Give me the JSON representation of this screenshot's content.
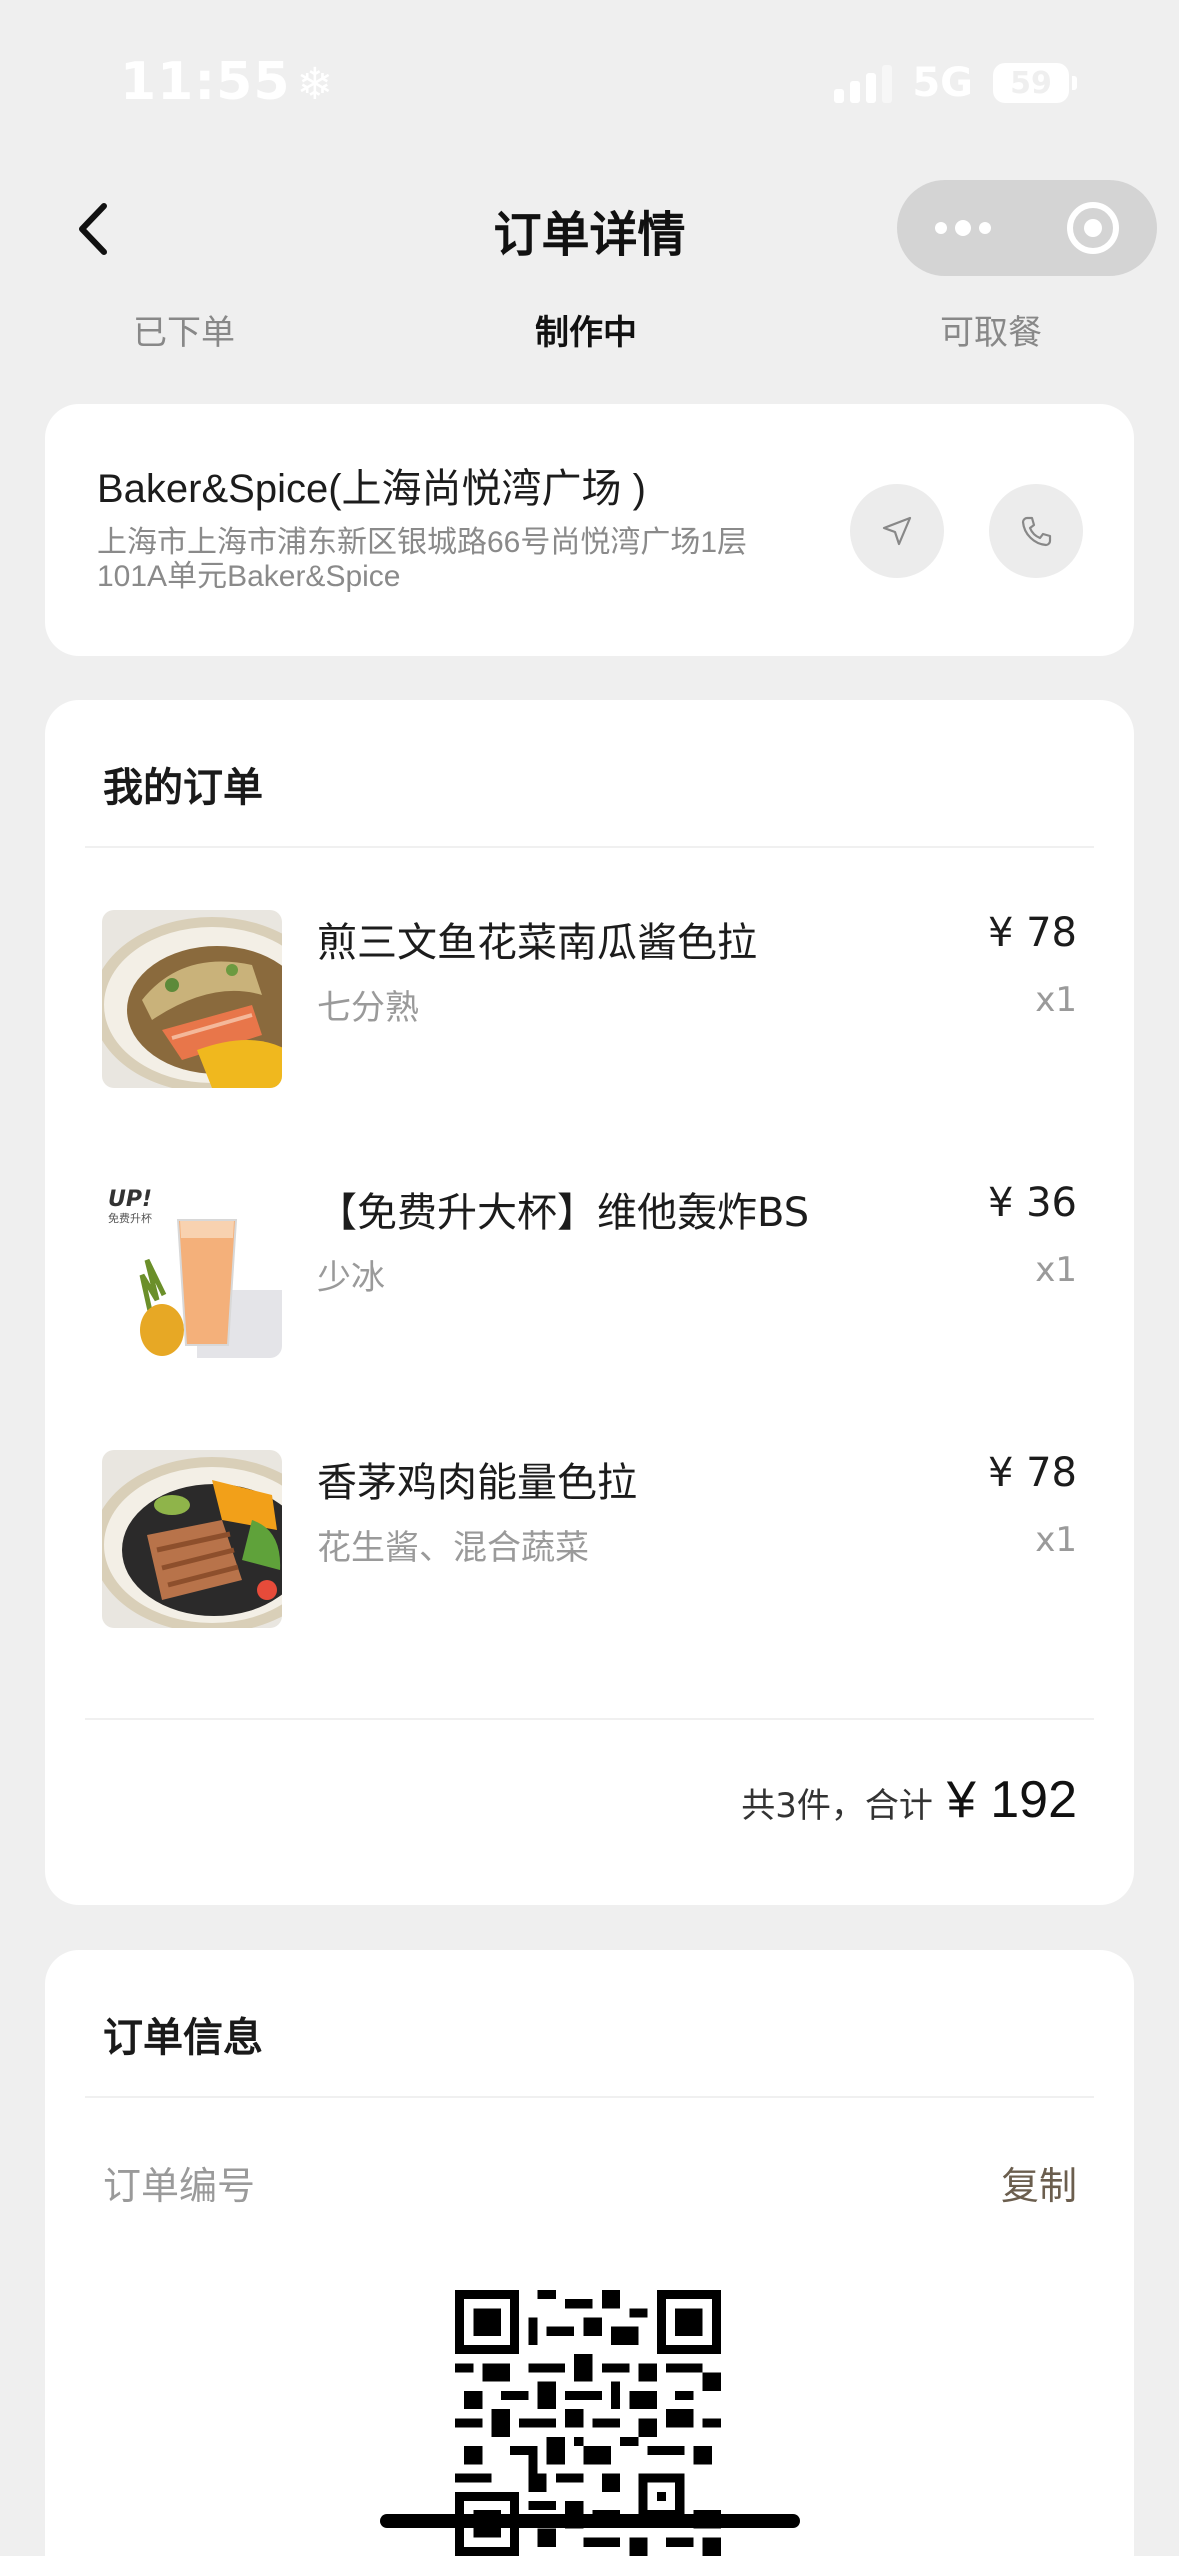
{
  "status_bar": {
    "time": "11:55",
    "snow_glyph": "❄",
    "network": "5G",
    "battery": "59"
  },
  "nav": {
    "title": "订单详情",
    "back_icon": "chevron-left-icon",
    "more_icon": "more-dots-icon",
    "close_icon": "target-icon"
  },
  "steps": [
    "已下单",
    "制作中",
    "可取餐"
  ],
  "store": {
    "name": "Baker&Spice(上海尚悦湾广场 )",
    "address": "上海市上海市浦东新区银城路66号尚悦湾广场1层101A单元Baker&Spice"
  },
  "order": {
    "title": "我的订单",
    "items": [
      {
        "name": "煎三文鱼花菜南瓜酱色拉",
        "spec": "七分熟",
        "price": "¥ 78",
        "qty": "x1"
      },
      {
        "name": "【免费升大杯】维他轰炸BS",
        "spec": "少冰",
        "price": "¥ 36",
        "qty": "x1"
      },
      {
        "name": "香茅鸡肉能量色拉",
        "spec": "花生酱、混合蔬菜",
        "price": "¥ 78",
        "qty": "x1"
      }
    ],
    "total_count": "共3件，合计",
    "total_amount": "¥ 192"
  },
  "info": {
    "title": "订单信息",
    "order_no_label": "订单编号",
    "copy": "复制"
  },
  "drink_badge": {
    "line1": "UP!",
    "line2": "免费升杯"
  },
  "colors": {
    "background": "#efefef",
    "card": "#ffffff",
    "copy_text": "#6b5e4e",
    "muted": "#9a9a9a"
  }
}
